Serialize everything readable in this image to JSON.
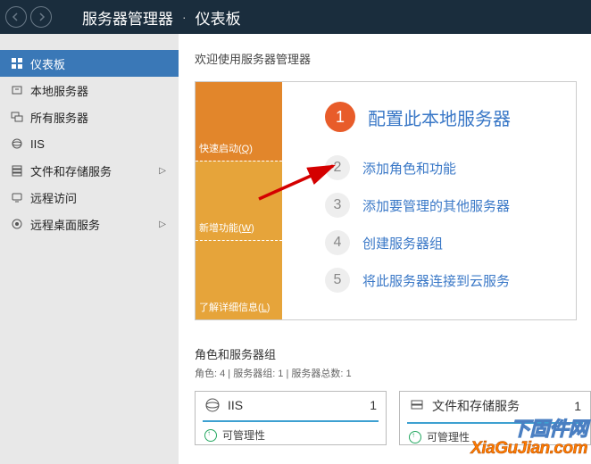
{
  "header": {
    "app_title": "服务器管理器",
    "breadcrumb_sep": "·",
    "page_title": "仪表板"
  },
  "sidebar": {
    "items": [
      {
        "label": "仪表板",
        "icon": "dashboard"
      },
      {
        "label": "本地服务器",
        "icon": "server"
      },
      {
        "label": "所有服务器",
        "icon": "servers"
      },
      {
        "label": "IIS",
        "icon": "iis"
      },
      {
        "label": "文件和存储服务",
        "icon": "storage",
        "expandable": true
      },
      {
        "label": "远程访问",
        "icon": "remote"
      },
      {
        "label": "远程桌面服务",
        "icon": "rds",
        "expandable": true
      }
    ]
  },
  "welcome": {
    "title": "欢迎使用服务器管理器"
  },
  "tiles": [
    {
      "label_pre": "快速启动(",
      "label_u": "Q",
      "label_post": ")"
    },
    {
      "label_pre": "新增功能(",
      "label_u": "W",
      "label_post": ")"
    },
    {
      "label_pre": "了解详细信息(",
      "label_u": "L",
      "label_post": ")"
    }
  ],
  "steps": [
    {
      "num": "1",
      "text": "配置此本地服务器",
      "hero": true
    },
    {
      "num": "2",
      "text": "添加角色和功能"
    },
    {
      "num": "3",
      "text": "添加要管理的其他服务器"
    },
    {
      "num": "4",
      "text": "创建服务器组"
    },
    {
      "num": "5",
      "text": "将此服务器连接到云服务"
    }
  ],
  "roles": {
    "title": "角色和服务器组",
    "subtitle": "角色: 4 | 服务器组: 1 | 服务器总数: 1",
    "tiles": [
      {
        "name": "IIS",
        "count": "1",
        "row": "可管理性"
      },
      {
        "name": "文件和存储服务",
        "count": "1",
        "row": "可管理性"
      }
    ]
  },
  "watermark": {
    "line1": "下固件网",
    "line2": "XiaGuJian.com"
  }
}
